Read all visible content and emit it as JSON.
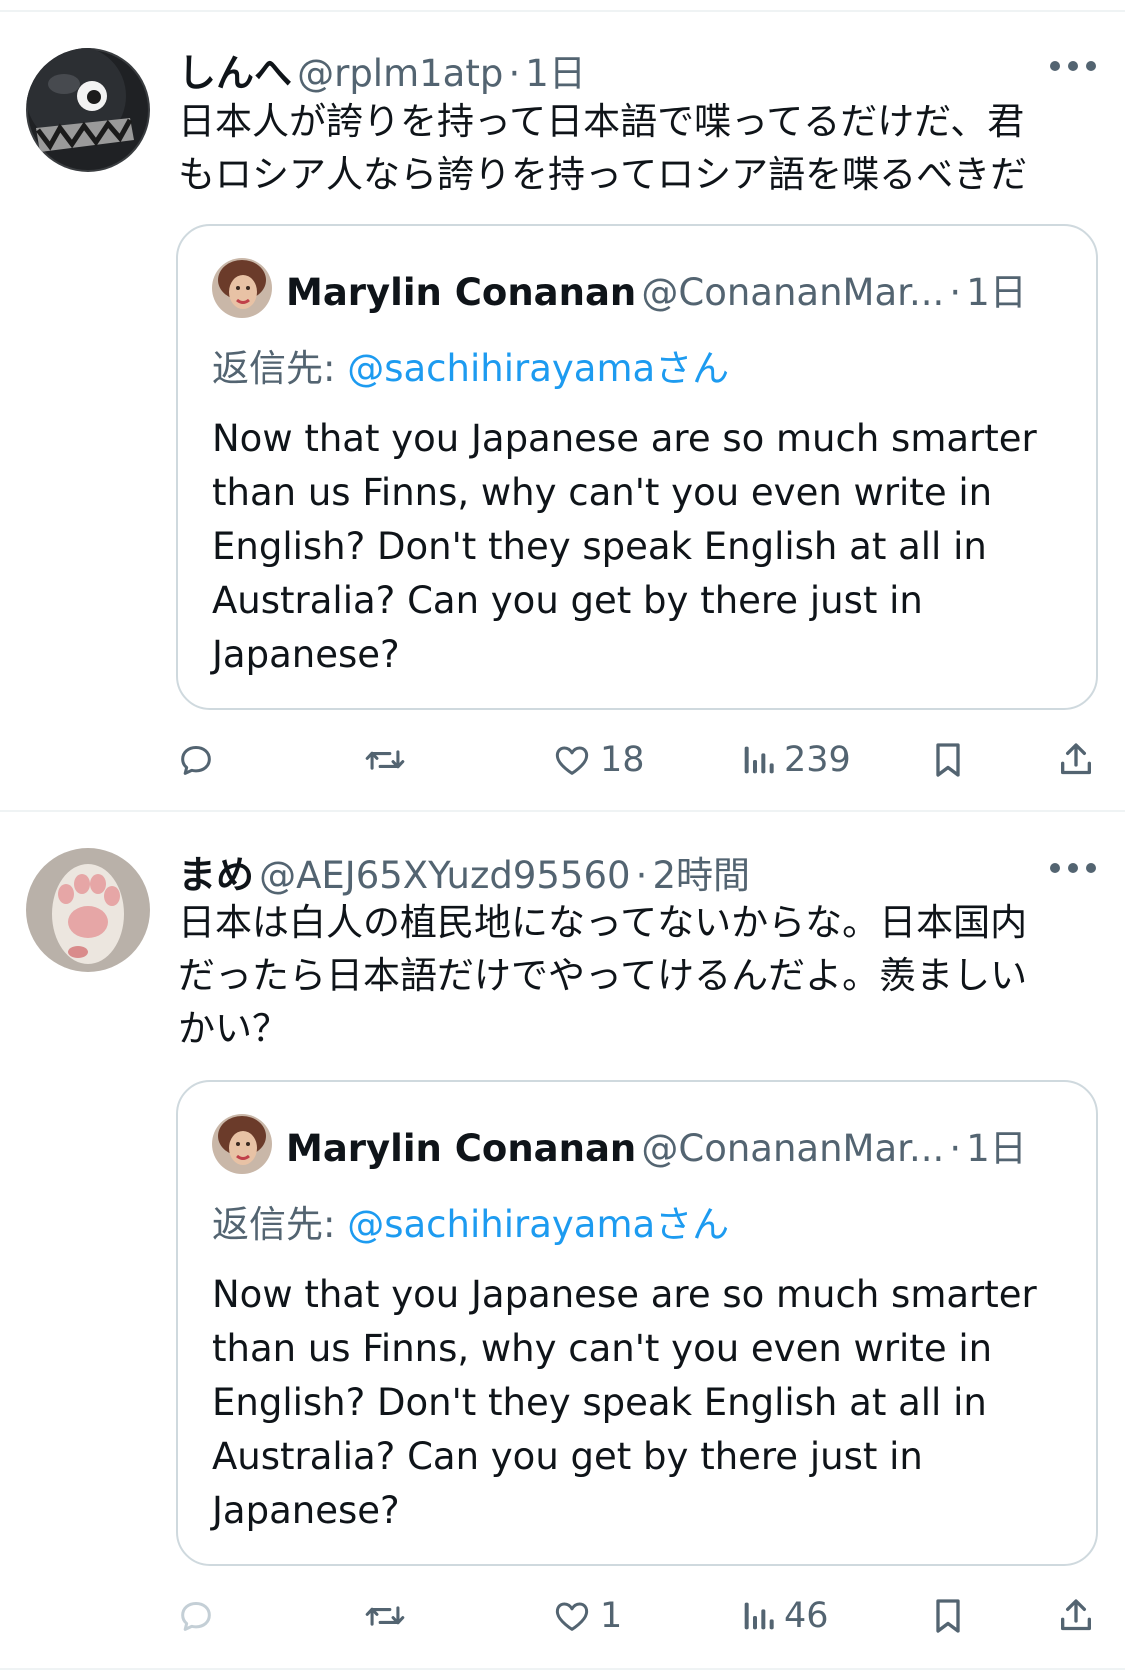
{
  "tweets": [
    {
      "author": {
        "display_name": "しんへ",
        "handle": "@rplm1atp",
        "time": "1日"
      },
      "text": "日本人が誇りを持って日本語で喋ってるだけだ、君\nもロシア人なら誇りを持ってロシア語を喋るべきだ",
      "quote": {
        "display_name": "Marylin Conanan",
        "handle": "@ConananMar...",
        "time": "1日",
        "reply_prefix": "返信先:",
        "reply_to": "@sachihirayamaさん",
        "text": "Now that you Japanese are so much smarter than us Finns, why can't you even write in English? Don't they speak English at all in Australia? Can you get by there just in Japanese?"
      },
      "actions": {
        "reply_count": "",
        "retweet_count": "",
        "like_count": "18",
        "view_count": "239"
      }
    },
    {
      "author": {
        "display_name": "まめ",
        "handle": "@AEJ65XYuzd95560",
        "time": "2時間"
      },
      "text": "日本は白人の植民地になってないからな。日本国内\nだったら日本語だけでやってけるんだよ。羨ましい\nかい？",
      "quote": {
        "display_name": "Marylin Conanan",
        "handle": "@ConananMar...",
        "time": "1日",
        "reply_prefix": "返信先:",
        "reply_to": "@sachihirayamaさん",
        "text": "Now that you Japanese are so much smarter than us Finns, why can't you even write in English? Don't they speak English at all in Australia? Can you get by there just in Japanese?"
      },
      "actions": {
        "reply_count": "",
        "retweet_count": "",
        "like_count": "1",
        "view_count": "46"
      }
    }
  ],
  "separator": "·",
  "icons": {
    "more": "more-horizontal-icon",
    "reply": "reply-bubble-icon",
    "retweet": "retweet-icon",
    "like": "heart-icon",
    "views": "bar-chart-icon",
    "bookmark": "bookmark-icon",
    "share": "share-upload-icon"
  },
  "colors": {
    "text": "#0f1419",
    "secondary": "#536471",
    "link": "#1d9bf0",
    "border": "#cfd9de"
  }
}
